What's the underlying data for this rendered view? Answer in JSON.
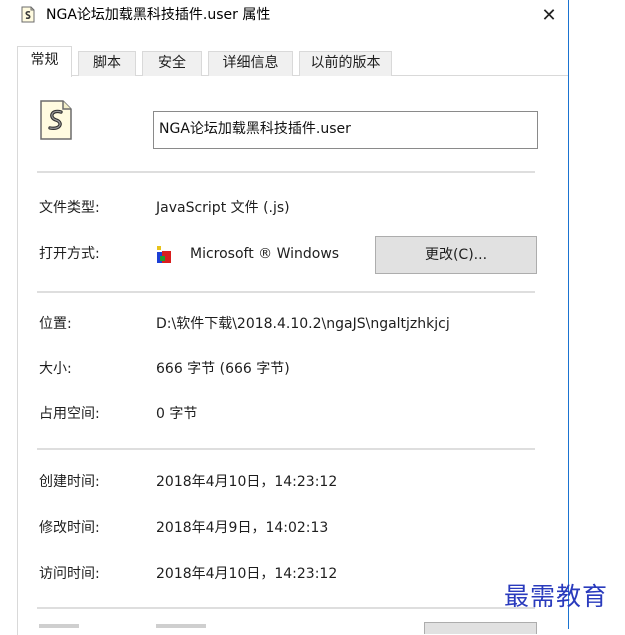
{
  "window": {
    "title": "NGA论坛加载黑科技插件.user 属性",
    "close_glyph": "✕"
  },
  "tabs": [
    {
      "label": "常规",
      "active": true
    },
    {
      "label": "脚本",
      "active": false
    },
    {
      "label": "安全",
      "active": false
    },
    {
      "label": "详细信息",
      "active": false
    },
    {
      "label": "以前的版本",
      "active": false
    }
  ],
  "general": {
    "filename": "NGA论坛加载黑科技插件.user",
    "file_icon": "script-file-icon",
    "file_type_label": "文件类型:",
    "file_type_value": "JavaScript 文件 (.js)",
    "opens_with_label": "打开方式:",
    "opens_with_value": "Microsoft ® Windows",
    "opens_with_icon": "windows-script-host-icon",
    "change_button": "更改(C)...",
    "location_label": "位置:",
    "location_value": "D:\\软件下载\\2018.4.10.2\\ngaJS\\ngaltjzhkjcj",
    "size_label": "大小:",
    "size_value": "666 字节 (666 字节)",
    "size_on_disk_label": "占用空间:",
    "size_on_disk_value": "0 字节",
    "created_label": "创建时间:",
    "created_value": "2018年4月10日，14:23:12",
    "modified_label": "修改时间:",
    "modified_value": "2018年4月9日，14:02:13",
    "accessed_label": "访问时间:",
    "accessed_value": "2018年4月10日，14:23:12"
  },
  "watermark": "最需教育",
  "colors": {
    "window_border": "#1a73d1",
    "watermark": "#2a3bbd",
    "button_face": "#e1e1e1"
  }
}
